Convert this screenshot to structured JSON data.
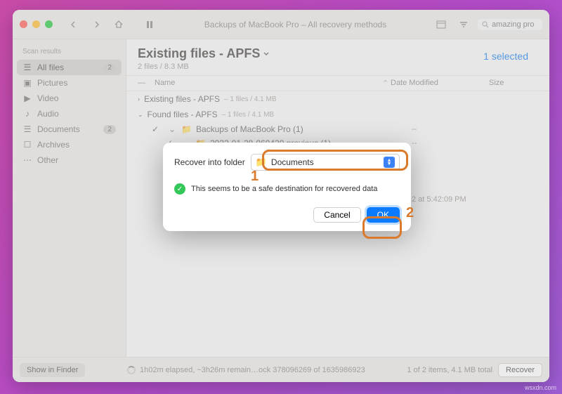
{
  "titlebar": {
    "title": "Backups of MacBook Pro – All recovery methods",
    "search_value": "amazing pro"
  },
  "sidebar": {
    "heading": "Scan results",
    "items": [
      {
        "label": "All files",
        "badge": "2",
        "icon": "grid-icon",
        "active": true
      },
      {
        "label": "Pictures",
        "icon": "picture-icon"
      },
      {
        "label": "Video",
        "icon": "video-icon"
      },
      {
        "label": "Audio",
        "icon": "audio-icon"
      },
      {
        "label": "Documents",
        "badge": "2",
        "icon": "document-icon"
      },
      {
        "label": "Archives",
        "icon": "archive-icon"
      },
      {
        "label": "Other",
        "icon": "other-icon"
      }
    ]
  },
  "main": {
    "title": "Existing files - APFS",
    "subtitle": "2 files / 8.3 MB",
    "selected_label": "1 selected",
    "columns": {
      "name": "Name",
      "date": "Date Modified",
      "size": "Size"
    },
    "groups": [
      {
        "label": "Existing files - APFS",
        "meta": "– 1 files / 4.1 MB",
        "expanded": false
      },
      {
        "label": "Found files - APFS",
        "meta": "– 1 files / 4.1 MB",
        "expanded": true
      }
    ],
    "rows": [
      {
        "indent": 1,
        "name": "Backups of MacBook Pro (1)",
        "date": "--",
        "size": ""
      },
      {
        "indent": 2,
        "name": "2022-01-28-060429.previous (1)",
        "date": "--",
        "size": ""
      },
      {
        "indent": 4,
        "name": "",
        "date": "2 at 5:42:09 PM",
        "size": ""
      }
    ]
  },
  "footer": {
    "show_in_finder": "Show in Finder",
    "status": "1h02m elapsed, ~3h26m remain…ock 378096269 of 1635986923",
    "count": "1 of 2 items, 4.1 MB total",
    "recover": "Recover"
  },
  "modal": {
    "label": "Recover into folder",
    "folder_name": "Documents",
    "safe_msg": "This seems to be a safe destination for recovered data",
    "cancel": "Cancel",
    "ok": "OK"
  },
  "annotations": {
    "one": "1",
    "two": "2"
  },
  "watermark": "wsxdn.com"
}
